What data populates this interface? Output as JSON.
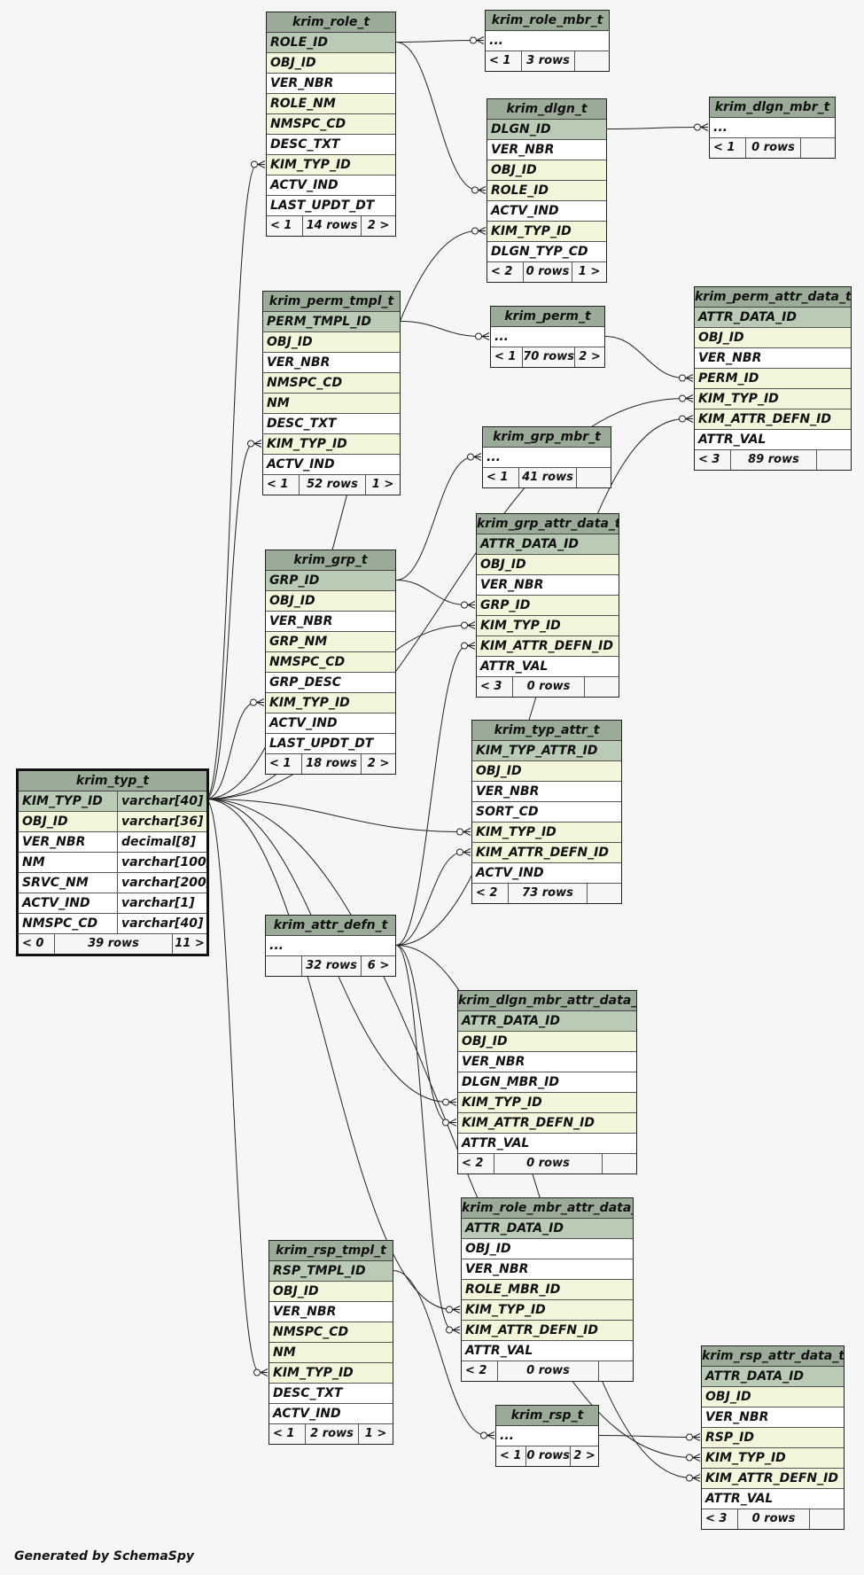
{
  "tables": [
    {
      "id": "krim_role_t",
      "name": "krim_role_t",
      "cols": [
        {
          "n": "ROLE_ID",
          "k": "pk"
        },
        {
          "n": "OBJ_ID",
          "k": "fk"
        },
        {
          "n": "VER_NBR",
          "k": "plain"
        },
        {
          "n": "ROLE_NM",
          "k": "fk"
        },
        {
          "n": "NMSPC_CD",
          "k": "fk"
        },
        {
          "n": "DESC_TXT",
          "k": "plain"
        },
        {
          "n": "KIM_TYP_ID",
          "k": "fk"
        },
        {
          "n": "ACTV_IND",
          "k": "plain"
        },
        {
          "n": "LAST_UPDT_DT",
          "k": "plain"
        }
      ],
      "parents": "< 1",
      "rows": "14 rows",
      "children": "2 >"
    },
    {
      "id": "krim_role_mbr_t",
      "name": "krim_role_mbr_t",
      "cols": [
        {
          "n": "...",
          "k": "plain"
        }
      ],
      "parents": "< 1",
      "rows": "3 rows",
      "children": ""
    },
    {
      "id": "krim_dlgn_t",
      "name": "krim_dlgn_t",
      "cols": [
        {
          "n": "DLGN_ID",
          "k": "pk"
        },
        {
          "n": "VER_NBR",
          "k": "plain"
        },
        {
          "n": "OBJ_ID",
          "k": "fk"
        },
        {
          "n": "ROLE_ID",
          "k": "fk"
        },
        {
          "n": "ACTV_IND",
          "k": "plain"
        },
        {
          "n": "KIM_TYP_ID",
          "k": "fk"
        },
        {
          "n": "DLGN_TYP_CD",
          "k": "plain"
        }
      ],
      "parents": "< 2",
      "rows": "0 rows",
      "children": "1 >"
    },
    {
      "id": "krim_dlgn_mbr_t",
      "name": "krim_dlgn_mbr_t",
      "cols": [
        {
          "n": "...",
          "k": "plain"
        }
      ],
      "parents": "< 1",
      "rows": "0 rows",
      "children": ""
    },
    {
      "id": "krim_perm_tmpl_t",
      "name": "krim_perm_tmpl_t",
      "cols": [
        {
          "n": "PERM_TMPL_ID",
          "k": "pk"
        },
        {
          "n": "OBJ_ID",
          "k": "fk"
        },
        {
          "n": "VER_NBR",
          "k": "plain"
        },
        {
          "n": "NMSPC_CD",
          "k": "fk"
        },
        {
          "n": "NM",
          "k": "fk"
        },
        {
          "n": "DESC_TXT",
          "k": "plain"
        },
        {
          "n": "KIM_TYP_ID",
          "k": "fk"
        },
        {
          "n": "ACTV_IND",
          "k": "plain"
        }
      ],
      "parents": "< 1",
      "rows": "52 rows",
      "children": "1 >"
    },
    {
      "id": "krim_perm_t",
      "name": "krim_perm_t",
      "cols": [
        {
          "n": "...",
          "k": "plain"
        }
      ],
      "parents": "< 1",
      "rows": "70 rows",
      "children": "2 >"
    },
    {
      "id": "krim_perm_attr_data_t",
      "name": "krim_perm_attr_data_t",
      "cols": [
        {
          "n": "ATTR_DATA_ID",
          "k": "pk"
        },
        {
          "n": "OBJ_ID",
          "k": "fk"
        },
        {
          "n": "VER_NBR",
          "k": "plain"
        },
        {
          "n": "PERM_ID",
          "k": "fk"
        },
        {
          "n": "KIM_TYP_ID",
          "k": "fk"
        },
        {
          "n": "KIM_ATTR_DEFN_ID",
          "k": "fk"
        },
        {
          "n": "ATTR_VAL",
          "k": "plain"
        }
      ],
      "parents": "< 3",
      "rows": "89 rows",
      "children": ""
    },
    {
      "id": "krim_grp_mbr_t",
      "name": "krim_grp_mbr_t",
      "cols": [
        {
          "n": "...",
          "k": "plain"
        }
      ],
      "parents": "< 1",
      "rows": "41 rows",
      "children": ""
    },
    {
      "id": "krim_grp_attr_data_t",
      "name": "krim_grp_attr_data_t",
      "cols": [
        {
          "n": "ATTR_DATA_ID",
          "k": "pk"
        },
        {
          "n": "OBJ_ID",
          "k": "fk"
        },
        {
          "n": "VER_NBR",
          "k": "plain"
        },
        {
          "n": "GRP_ID",
          "k": "fk"
        },
        {
          "n": "KIM_TYP_ID",
          "k": "fk"
        },
        {
          "n": "KIM_ATTR_DEFN_ID",
          "k": "fk"
        },
        {
          "n": "ATTR_VAL",
          "k": "plain"
        }
      ],
      "parents": "< 3",
      "rows": "0 rows",
      "children": ""
    },
    {
      "id": "krim_grp_t",
      "name": "krim_grp_t",
      "cols": [
        {
          "n": "GRP_ID",
          "k": "pk"
        },
        {
          "n": "OBJ_ID",
          "k": "fk"
        },
        {
          "n": "VER_NBR",
          "k": "plain"
        },
        {
          "n": "GRP_NM",
          "k": "fk"
        },
        {
          "n": "NMSPC_CD",
          "k": "fk"
        },
        {
          "n": "GRP_DESC",
          "k": "plain"
        },
        {
          "n": "KIM_TYP_ID",
          "k": "fk"
        },
        {
          "n": "ACTV_IND",
          "k": "plain"
        },
        {
          "n": "LAST_UPDT_DT",
          "k": "plain"
        }
      ],
      "parents": "< 1",
      "rows": "18 rows",
      "children": "2 >"
    },
    {
      "id": "krim_typ_attr_t",
      "name": "krim_typ_attr_t",
      "cols": [
        {
          "n": "KIM_TYP_ATTR_ID",
          "k": "pk"
        },
        {
          "n": "OBJ_ID",
          "k": "fk"
        },
        {
          "n": "VER_NBR",
          "k": "plain"
        },
        {
          "n": "SORT_CD",
          "k": "plain"
        },
        {
          "n": "KIM_TYP_ID",
          "k": "fk"
        },
        {
          "n": "KIM_ATTR_DEFN_ID",
          "k": "fk"
        },
        {
          "n": "ACTV_IND",
          "k": "plain"
        }
      ],
      "parents": "< 2",
      "rows": "73 rows",
      "children": ""
    },
    {
      "id": "krim_typ_t",
      "name": "krim_typ_t",
      "main": true,
      "cols": [
        {
          "n": "KIM_TYP_ID",
          "k": "pk",
          "t": "varchar[40]"
        },
        {
          "n": "OBJ_ID",
          "k": "fk",
          "t": "varchar[36]"
        },
        {
          "n": "VER_NBR",
          "k": "plain",
          "t": "decimal[8]"
        },
        {
          "n": "NM",
          "k": "plain",
          "t": "varchar[100]"
        },
        {
          "n": "SRVC_NM",
          "k": "plain",
          "t": "varchar[200]"
        },
        {
          "n": "ACTV_IND",
          "k": "plain",
          "t": "varchar[1]"
        },
        {
          "n": "NMSPC_CD",
          "k": "plain",
          "t": "varchar[40]"
        }
      ],
      "parents": "< 0",
      "rows": "39 rows",
      "children": "11 >"
    },
    {
      "id": "krim_attr_defn_t",
      "name": "krim_attr_defn_t",
      "cols": [
        {
          "n": "...",
          "k": "plain"
        }
      ],
      "parents": "",
      "rows": "32 rows",
      "children": "6 >"
    },
    {
      "id": "krim_dlgn_mbr_attr_data_t",
      "name": "krim_dlgn_mbr_attr_data_t",
      "cols": [
        {
          "n": "ATTR_DATA_ID",
          "k": "pk"
        },
        {
          "n": "OBJ_ID",
          "k": "fk"
        },
        {
          "n": "VER_NBR",
          "k": "plain"
        },
        {
          "n": "DLGN_MBR_ID",
          "k": "plain"
        },
        {
          "n": "KIM_TYP_ID",
          "k": "fk"
        },
        {
          "n": "KIM_ATTR_DEFN_ID",
          "k": "fk"
        },
        {
          "n": "ATTR_VAL",
          "k": "plain"
        }
      ],
      "parents": "< 2",
      "rows": "0 rows",
      "children": ""
    },
    {
      "id": "krim_role_mbr_attr_data_t",
      "name": "krim_role_mbr_attr_data_t",
      "cols": [
        {
          "n": "ATTR_DATA_ID",
          "k": "pk"
        },
        {
          "n": "OBJ_ID",
          "k": "plain"
        },
        {
          "n": "VER_NBR",
          "k": "plain"
        },
        {
          "n": "ROLE_MBR_ID",
          "k": "fk"
        },
        {
          "n": "KIM_TYP_ID",
          "k": "fk"
        },
        {
          "n": "KIM_ATTR_DEFN_ID",
          "k": "fk"
        },
        {
          "n": "ATTR_VAL",
          "k": "plain"
        }
      ],
      "parents": "< 2",
      "rows": "0 rows",
      "children": ""
    },
    {
      "id": "krim_rsp_tmpl_t",
      "name": "krim_rsp_tmpl_t",
      "cols": [
        {
          "n": "RSP_TMPL_ID",
          "k": "pk"
        },
        {
          "n": "OBJ_ID",
          "k": "fk"
        },
        {
          "n": "VER_NBR",
          "k": "plain"
        },
        {
          "n": "NMSPC_CD",
          "k": "fk"
        },
        {
          "n": "NM",
          "k": "fk"
        },
        {
          "n": "KIM_TYP_ID",
          "k": "fk"
        },
        {
          "n": "DESC_TXT",
          "k": "plain"
        },
        {
          "n": "ACTV_IND",
          "k": "plain"
        }
      ],
      "parents": "< 1",
      "rows": "2 rows",
      "children": "1 >"
    },
    {
      "id": "krim_rsp_t",
      "name": "krim_rsp_t",
      "cols": [
        {
          "n": "...",
          "k": "plain"
        }
      ],
      "parents": "< 1",
      "rows": "0 rows",
      "children": "2 >"
    },
    {
      "id": "krim_rsp_attr_data_t",
      "name": "krim_rsp_attr_data_t",
      "cols": [
        {
          "n": "ATTR_DATA_ID",
          "k": "pk"
        },
        {
          "n": "OBJ_ID",
          "k": "fk"
        },
        {
          "n": "VER_NBR",
          "k": "plain"
        },
        {
          "n": "RSP_ID",
          "k": "fk"
        },
        {
          "n": "KIM_TYP_ID",
          "k": "fk"
        },
        {
          "n": "KIM_ATTR_DEFN_ID",
          "k": "fk"
        },
        {
          "n": "ATTR_VAL",
          "k": "plain"
        }
      ],
      "parents": "< 3",
      "rows": "0 rows",
      "children": ""
    }
  ],
  "relations": [
    {
      "from": "krim_role_t",
      "fc": 0,
      "to": "krim_role_mbr_t",
      "tc": 0
    },
    {
      "from": "krim_role_t",
      "fc": 0,
      "to": "krim_dlgn_t",
      "tc": 3
    },
    {
      "from": "krim_dlgn_t",
      "fc": 0,
      "to": "krim_dlgn_mbr_t",
      "tc": 0
    },
    {
      "from": "krim_perm_tmpl_t",
      "fc": 0,
      "to": "krim_perm_t",
      "tc": 0
    },
    {
      "from": "krim_perm_t",
      "fc": 0,
      "to": "krim_perm_attr_data_t",
      "tc": 3
    },
    {
      "from": "krim_grp_t",
      "fc": 0,
      "to": "krim_grp_mbr_t",
      "tc": 0
    },
    {
      "from": "krim_grp_t",
      "fc": 0,
      "to": "krim_grp_attr_data_t",
      "tc": 3
    },
    {
      "from": "krim_rsp_tmpl_t",
      "fc": 0,
      "to": "krim_rsp_t",
      "tc": 0
    },
    {
      "from": "krim_rsp_t",
      "fc": 0,
      "to": "krim_rsp_attr_data_t",
      "tc": 3
    },
    {
      "from": "krim_typ_t",
      "fc": 0,
      "to": "krim_role_t",
      "tc": 6
    },
    {
      "from": "krim_typ_t",
      "fc": 0,
      "to": "krim_dlgn_t",
      "tc": 5
    },
    {
      "from": "krim_typ_t",
      "fc": 0,
      "to": "krim_perm_tmpl_t",
      "tc": 6
    },
    {
      "from": "krim_typ_t",
      "fc": 0,
      "to": "krim_perm_attr_data_t",
      "tc": 4
    },
    {
      "from": "krim_typ_t",
      "fc": 0,
      "to": "krim_grp_t",
      "tc": 6
    },
    {
      "from": "krim_typ_t",
      "fc": 0,
      "to": "krim_grp_attr_data_t",
      "tc": 4
    },
    {
      "from": "krim_typ_t",
      "fc": 0,
      "to": "krim_typ_attr_t",
      "tc": 4
    },
    {
      "from": "krim_typ_t",
      "fc": 0,
      "to": "krim_dlgn_mbr_attr_data_t",
      "tc": 4
    },
    {
      "from": "krim_typ_t",
      "fc": 0,
      "to": "krim_role_mbr_attr_data_t",
      "tc": 4
    },
    {
      "from": "krim_typ_t",
      "fc": 0,
      "to": "krim_rsp_tmpl_t",
      "tc": 5
    },
    {
      "from": "krim_typ_t",
      "fc": 0,
      "to": "krim_rsp_attr_data_t",
      "tc": 4
    },
    {
      "from": "krim_attr_defn_t",
      "fc": 0,
      "to": "krim_perm_attr_data_t",
      "tc": 5
    },
    {
      "from": "krim_attr_defn_t",
      "fc": 0,
      "to": "krim_grp_attr_data_t",
      "tc": 5
    },
    {
      "from": "krim_attr_defn_t",
      "fc": 0,
      "to": "krim_typ_attr_t",
      "tc": 5
    },
    {
      "from": "krim_attr_defn_t",
      "fc": 0,
      "to": "krim_dlgn_mbr_attr_data_t",
      "tc": 5
    },
    {
      "from": "krim_attr_defn_t",
      "fc": 0,
      "to": "krim_role_mbr_attr_data_t",
      "tc": 5
    },
    {
      "from": "krim_attr_defn_t",
      "fc": 0,
      "to": "krim_rsp_attr_data_t",
      "tc": 5
    }
  ],
  "footer": "Generated by SchemaSpy",
  "colors": {
    "title": "#9aab97",
    "pk": "#b9cab5",
    "fk": "#f4f6dc",
    "plain": "#ffffff",
    "background": "#f6f6f6"
  }
}
